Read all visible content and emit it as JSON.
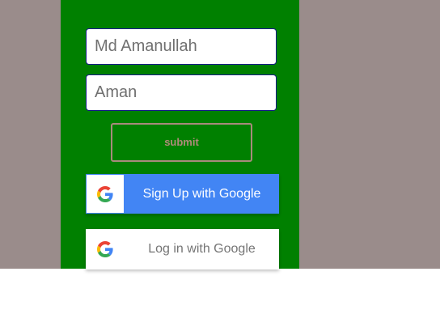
{
  "form": {
    "name_value": "Md Amanullah",
    "nickname_value": "Aman",
    "submit_label": "submit"
  },
  "google": {
    "signup_label": "Sign Up with Google",
    "login_label": "Log in with Google",
    "icon": "google-g-icon"
  },
  "colors": {
    "backdrop": "#9a8c8b",
    "panel": "#008000",
    "google_blue": "#4285f4",
    "submit_border": "#a88a7c"
  }
}
